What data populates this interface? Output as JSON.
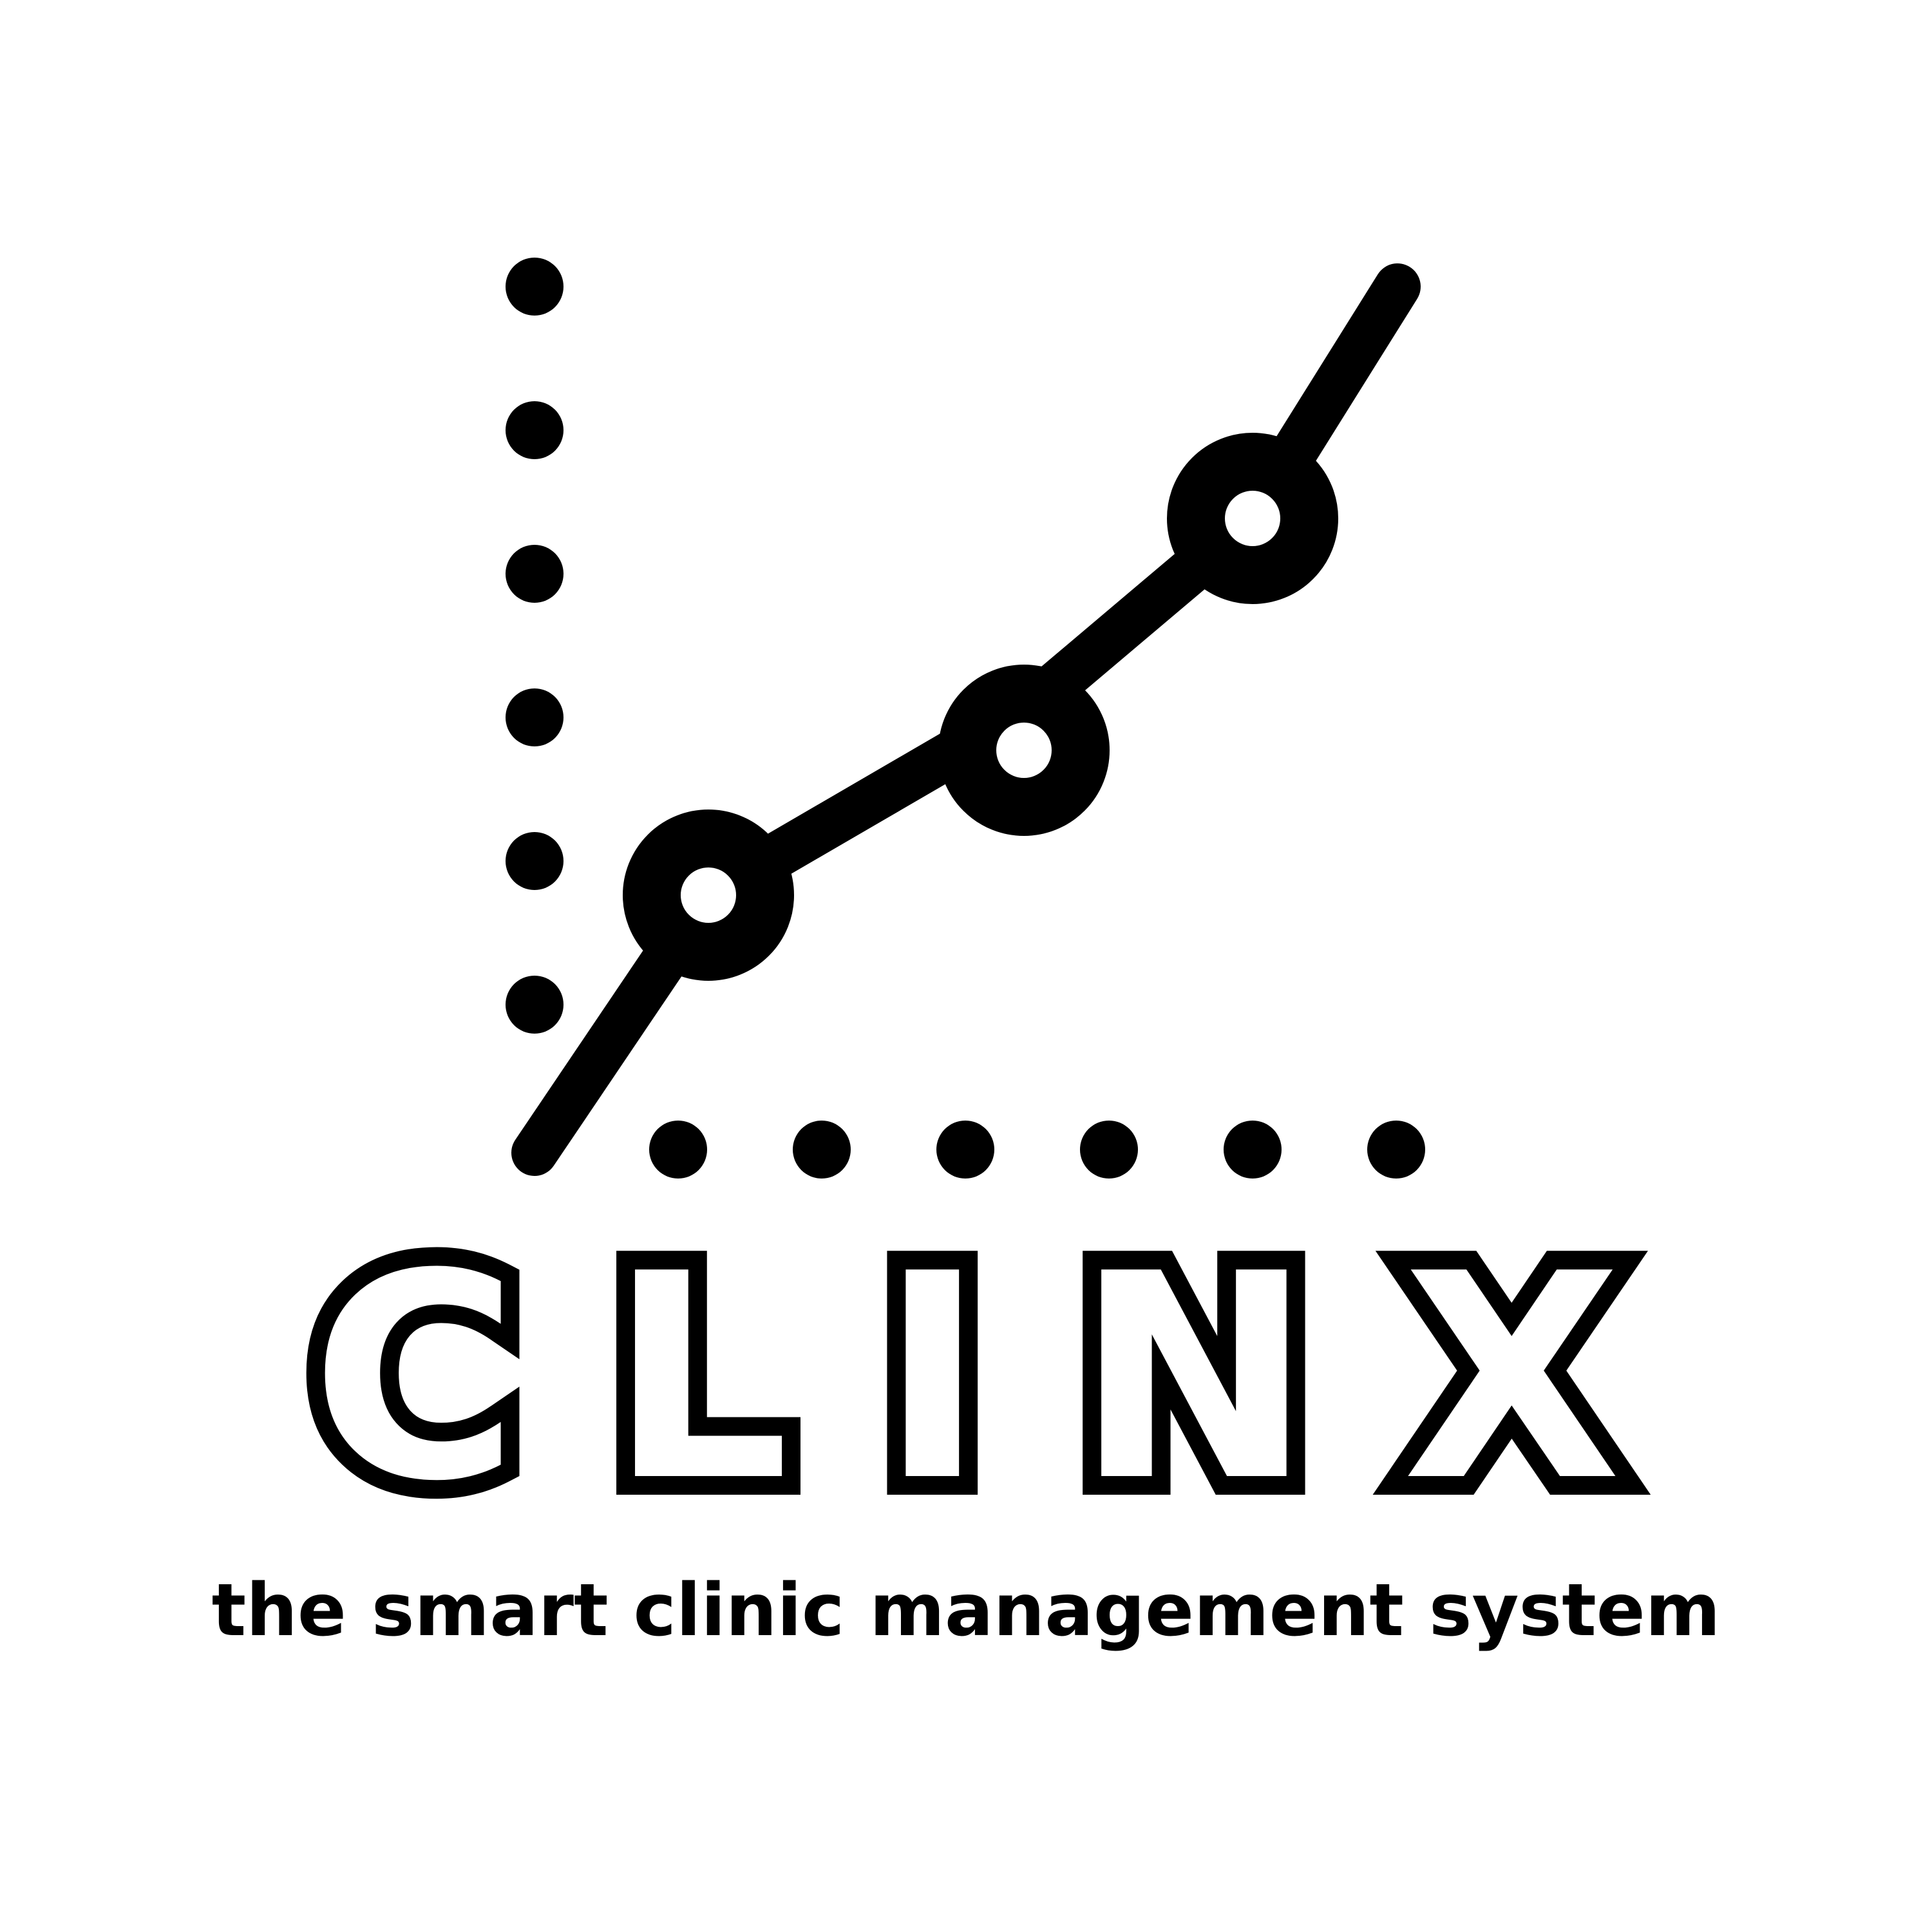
{
  "brand": {
    "name": "CLINX",
    "tagline": "the smart clinic management system"
  },
  "logo_mark": {
    "icon": "rising-line-chart-icon",
    "markers": 3
  },
  "colors": {
    "foreground": "#000000",
    "background": "#ffffff"
  }
}
